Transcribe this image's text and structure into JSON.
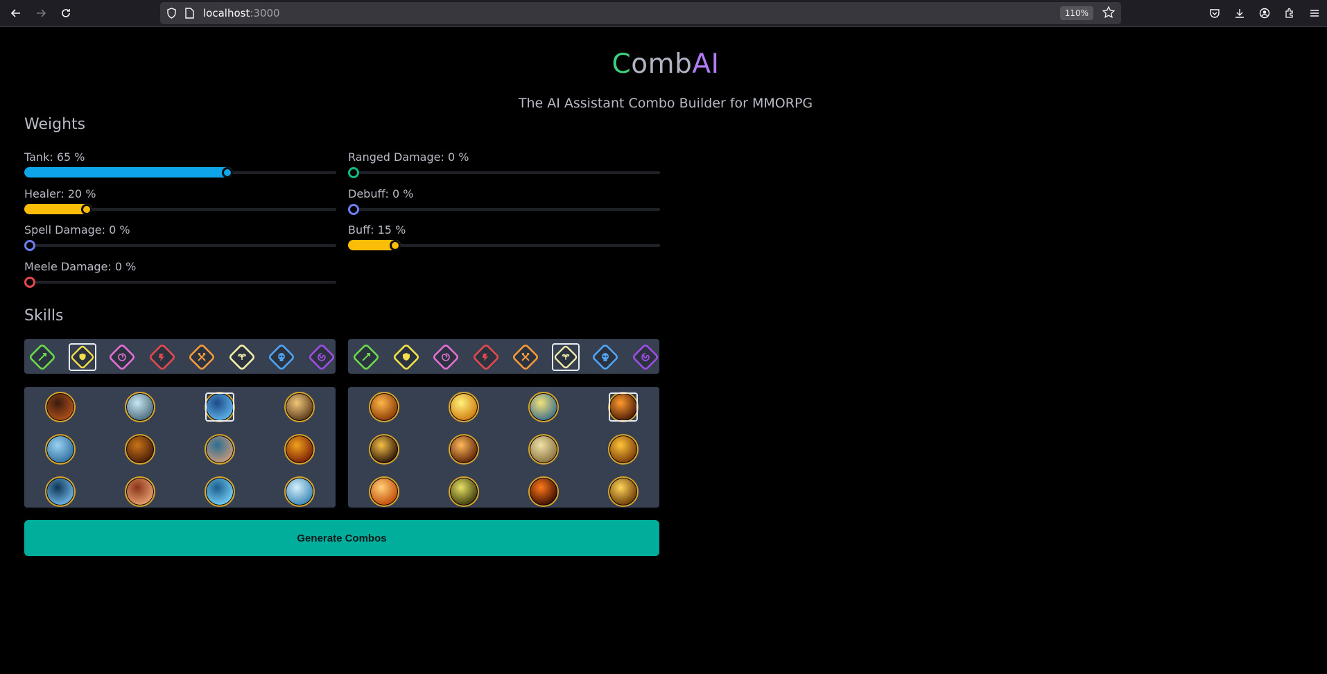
{
  "browser": {
    "url_host": "localhost",
    "url_port": ":3000",
    "zoom": "110%"
  },
  "header": {
    "title_c": "C",
    "title_mid": "omb",
    "title_ai": "AI",
    "subtitle": "The AI Assistant Combo Builder for MMORPG"
  },
  "weights": {
    "heading": "Weights",
    "sliders": [
      {
        "label": "Tank: 65 %",
        "value": 65,
        "color": "#0ea5e9"
      },
      {
        "label": "Healer: 20 %",
        "value": 20,
        "color": "#fbbd08"
      },
      {
        "label": "Spell Damage: 0 %",
        "value": 0,
        "color": "#6d7ff0"
      },
      {
        "label": "Meele Damage: 0 %",
        "value": 0,
        "color": "#e5484d"
      },
      {
        "label": "Ranged Damage: 0 %",
        "value": 0,
        "color": "#10b981"
      },
      {
        "label": "Debuff: 0 %",
        "value": 0,
        "color": "#6d7ff0"
      },
      {
        "label": "Buff: 15 %",
        "value": 15,
        "color": "#fbbd08"
      }
    ]
  },
  "skills": {
    "heading": "Skills",
    "class_colors": [
      "#6bd94c",
      "#f2e148",
      "#e36fd0",
      "#e5484d",
      "#f59a3a",
      "#f2eea8",
      "#4fa4f5",
      "#a04de6"
    ],
    "class_names": [
      "ranger-icon",
      "guardian-icon",
      "mind-icon",
      "warrior-icon",
      "berserker-icon",
      "nature-icon",
      "necro-icon",
      "arcane-icon"
    ],
    "left_selected_class": 1,
    "right_selected_class": 5,
    "left_skills": [
      "fortress-skill",
      "feathers-skill",
      "shield-skill",
      "armor-skill",
      "ice-shield-skill",
      "hammer-skill",
      "handshake-skill",
      "fire-beast-skill",
      "vortex-skill",
      "rage-face-skill",
      "whirlwind-skill",
      "waterfall-skill"
    ],
    "right_skills": [
      "slash-skill",
      "light-beam-skill",
      "sword-spark-skill",
      "radiance-skill",
      "zigzag-skill",
      "fire-sword-skill",
      "prayer-skill",
      "wings-skill",
      "sunburst-skill",
      "golden-aura-skill",
      "eruption-skill",
      "golden-rune-skill"
    ],
    "left_selected_skill": 2,
    "right_selected_skill": 3
  },
  "actions": {
    "generate_label": "Generate Combos"
  }
}
